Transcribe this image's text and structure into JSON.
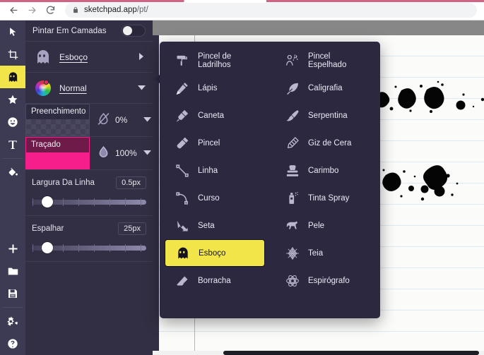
{
  "browser": {
    "back_icon": "arrow-left-icon",
    "forward_icon": "arrow-right-icon",
    "reload_icon": "reload-icon",
    "lock_icon": "lock-icon",
    "url_host": "sketchpad.app",
    "url_path": "/pt/"
  },
  "rail": {
    "tools": [
      {
        "name": "select-tool",
        "icon": "cursor-arrow-icon",
        "active": false
      },
      {
        "name": "crop-tool",
        "icon": "crop-icon",
        "active": false
      },
      {
        "name": "draw-tool",
        "icon": "ghost-icon",
        "active": true
      },
      {
        "name": "shape-tool",
        "icon": "star-icon",
        "active": false
      },
      {
        "name": "sticker-tool",
        "icon": "emoji-icon",
        "active": false
      },
      {
        "name": "text-tool",
        "icon": "text-t-icon",
        "active": false
      },
      {
        "name": "fill-tool",
        "icon": "paint-bucket-icon",
        "active": false
      },
      {
        "name": "new-button",
        "icon": "plus-icon",
        "active": false
      },
      {
        "name": "open-button",
        "icon": "folder-icon",
        "active": false
      },
      {
        "name": "save-button",
        "icon": "floppy-disk-icon",
        "active": false
      },
      {
        "name": "settings-button",
        "icon": "gears-icon",
        "active": false
      },
      {
        "name": "help-button",
        "icon": "question-circle-icon",
        "active": false
      }
    ]
  },
  "panel": {
    "header_title": "Pintar Em Camadas",
    "header_toggle_state": "on",
    "tool": {
      "label": "Esboço",
      "icon": "ghost-icon",
      "caret": "chevron-right-icon"
    },
    "blend": {
      "label": "Normal",
      "icon": "color-wheel-icon",
      "caret": "chevron-down-icon"
    },
    "fill": {
      "label": "Preenchimento",
      "opacity": "0%",
      "swatch": "transparent",
      "icon": "droplet-slashed-icon",
      "caret": "chevron-down-icon"
    },
    "stroke": {
      "label": "Traçado",
      "opacity": "100%",
      "swatch_color": "#f51e8a",
      "icon": "droplet-icon",
      "caret": "chevron-down-icon"
    },
    "line_width": {
      "label": "Largura Da Linha",
      "value": "0.5px",
      "percent": 8
    },
    "spread": {
      "label": "Espalhar",
      "value": "25px",
      "percent": 8
    }
  },
  "flyout": {
    "left_column": [
      {
        "label": "Pincel de Ladrilhos",
        "icon": "paint-roller-icon",
        "selected": false
      },
      {
        "label": "Lápis",
        "icon": "pencil-icon",
        "selected": false
      },
      {
        "label": "Caneta",
        "icon": "pen-nib-icon",
        "selected": false
      },
      {
        "label": "Pincel",
        "icon": "paintbrush-icon",
        "selected": false
      },
      {
        "label": "Linha",
        "icon": "line-segment-icon",
        "selected": false
      },
      {
        "label": "Curso",
        "icon": "curve-path-icon",
        "selected": false
      },
      {
        "label": "Seta",
        "icon": "arrow-down-right-icon",
        "selected": false
      },
      {
        "label": "Esboço",
        "icon": "ghost-icon",
        "selected": true
      },
      {
        "label": "Borracha",
        "icon": "eraser-icon",
        "selected": false
      }
    ],
    "right_column": [
      {
        "label": "Pincel Espelhado",
        "icon": "mirror-brush-icon",
        "selected": false
      },
      {
        "label": "Caligrafia",
        "icon": "quill-feather-icon",
        "selected": false
      },
      {
        "label": "Serpentina",
        "icon": "streamer-brush-icon",
        "selected": false
      },
      {
        "label": "Giz de Cera",
        "icon": "crayon-icon",
        "selected": false
      },
      {
        "label": "Carimbo",
        "icon": "rubber-stamp-icon",
        "selected": false
      },
      {
        "label": "Tinta Spray",
        "icon": "spray-can-icon",
        "selected": false
      },
      {
        "label": "Pele",
        "icon": "fur-animal-icon",
        "selected": false
      },
      {
        "label": "Teia",
        "icon": "spider-web-icon",
        "selected": false
      },
      {
        "label": "Espirógrafo",
        "icon": "spirograph-icon",
        "selected": false
      }
    ]
  },
  "canvas": {
    "paper_style": "ruled-lined-paper",
    "margin_line_color": "#e8a0ad",
    "rule_line_color": "#dfe9f0",
    "ink_color": "#000000"
  }
}
